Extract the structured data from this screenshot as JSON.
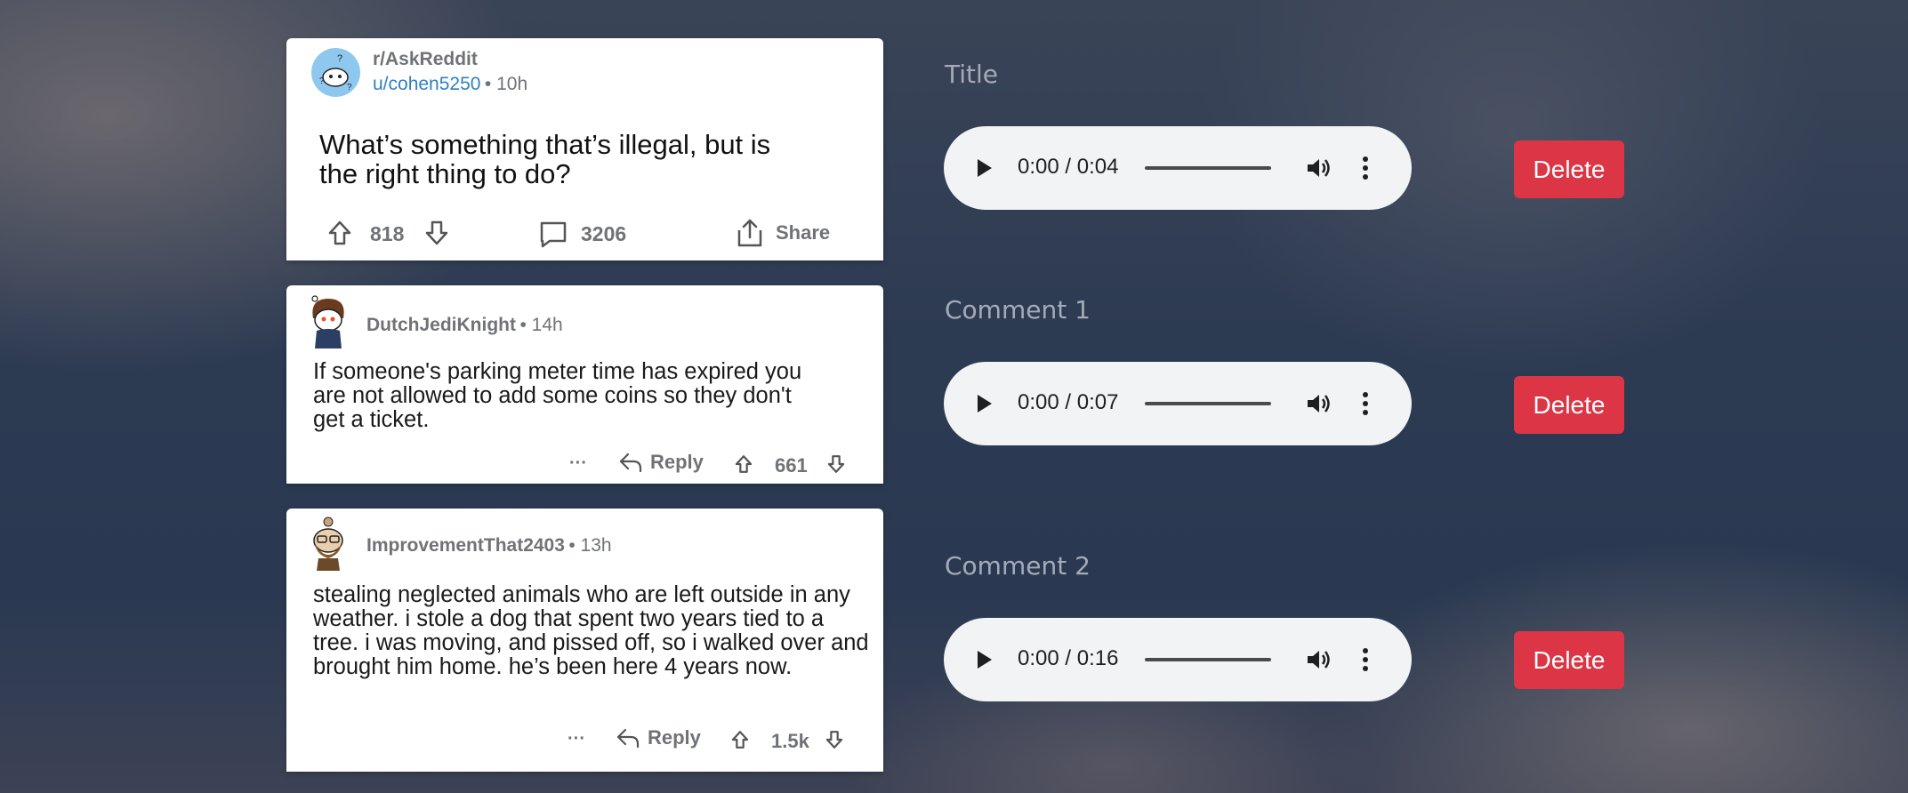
{
  "title_card": {
    "subreddit": "r/AskReddit",
    "username": "u/cohen5250",
    "age": "• 10h",
    "text": "What’s something that’s illegal, but is the right thing to do?",
    "upvotes": "818",
    "comments": "3206",
    "share_label": "Share"
  },
  "comments": [
    {
      "username": "DutchJediKnight",
      "age": "• 14h",
      "text": "If someone's parking meter time has expired you are not allowed to add some coins so they don't get a ticket.",
      "more": "···",
      "reply_label": "Reply",
      "score": "661"
    },
    {
      "username": "ImprovementThat2403",
      "age": "• 13h",
      "text": "stealing neglected animals who are left outside in any weather. i stole a dog that spent two years tied to a tree. i was moving, and pissed off, so i walked over and brought him home. he’s been here 4 years now.",
      "more": "···",
      "reply_label": "Reply",
      "score": "1.5k"
    }
  ],
  "sections": [
    {
      "label": "Title",
      "time": "0:00 / 0:04",
      "delete_label": "Delete"
    },
    {
      "label": "Comment 1",
      "time": "0:00 / 0:07",
      "delete_label": "Delete"
    },
    {
      "label": "Comment 2",
      "time": "0:00 / 0:16",
      "delete_label": "Delete"
    }
  ],
  "icons": {
    "upvote": "arrow-up-outline-icon",
    "downvote": "arrow-down-outline-icon",
    "comment": "speech-bubble-icon",
    "share": "share-icon",
    "reply": "reply-arrow-icon",
    "play": "play-icon",
    "volume": "volume-icon",
    "menu": "kebab-menu-icon"
  },
  "colors": {
    "delete": "#dc3545",
    "username_link": "#2f7fc4",
    "player_bg": "#f1f3f4"
  }
}
